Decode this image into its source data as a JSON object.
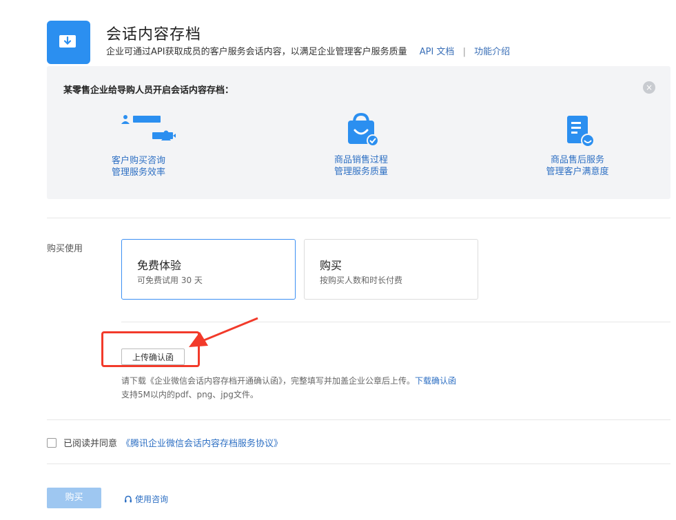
{
  "header": {
    "title": "会话内容存档",
    "description": "企业可通过API获取成员的客户服务会话内容，以满足企业管理客户服务质量",
    "api_doc_link": "API 文档",
    "separator": "|",
    "intro_link": "功能介绍"
  },
  "banner": {
    "title": "某零售企业给导购人员开启会话内容存档：",
    "close_glyph": "×",
    "features": [
      {
        "line1": "客户购买咨询",
        "line2": "管理服务效率",
        "icon": "chat-people-icon"
      },
      {
        "line1": "商品销售过程",
        "line2": "管理服务质量",
        "icon": "shopping-bag-icon"
      },
      {
        "line1": "商品售后服务",
        "line2": "管理客户满意度",
        "icon": "document-smile-icon"
      }
    ]
  },
  "purchase": {
    "label": "购买使用",
    "options": [
      {
        "title": "免费体验",
        "subtitle": "可免费试用 30 天",
        "selected": true
      },
      {
        "title": "购买",
        "subtitle": "按购买人数和时长付费",
        "selected": false
      }
    ]
  },
  "upload": {
    "button_label": "上传确认函",
    "hint_line1": "请下载《企业微信会话内容存档开通确认函》，完整填写并加盖企业公章后上传。",
    "download_link": "下载确认函",
    "hint_line2": "支持5M以内的pdf、png、jpg文件。"
  },
  "agreement": {
    "checked": false,
    "label": "已阅读并同意",
    "link": "《腾讯企业微信会话内容存档服务协议》"
  },
  "footer": {
    "buy_button": "购买",
    "consult_link": "使用咨询"
  },
  "colors": {
    "brand_blue": "#2b8ff0",
    "link_blue": "#2d6fc3",
    "highlight_red": "#f23a2a",
    "disabled_button": "#9ec7f1"
  }
}
